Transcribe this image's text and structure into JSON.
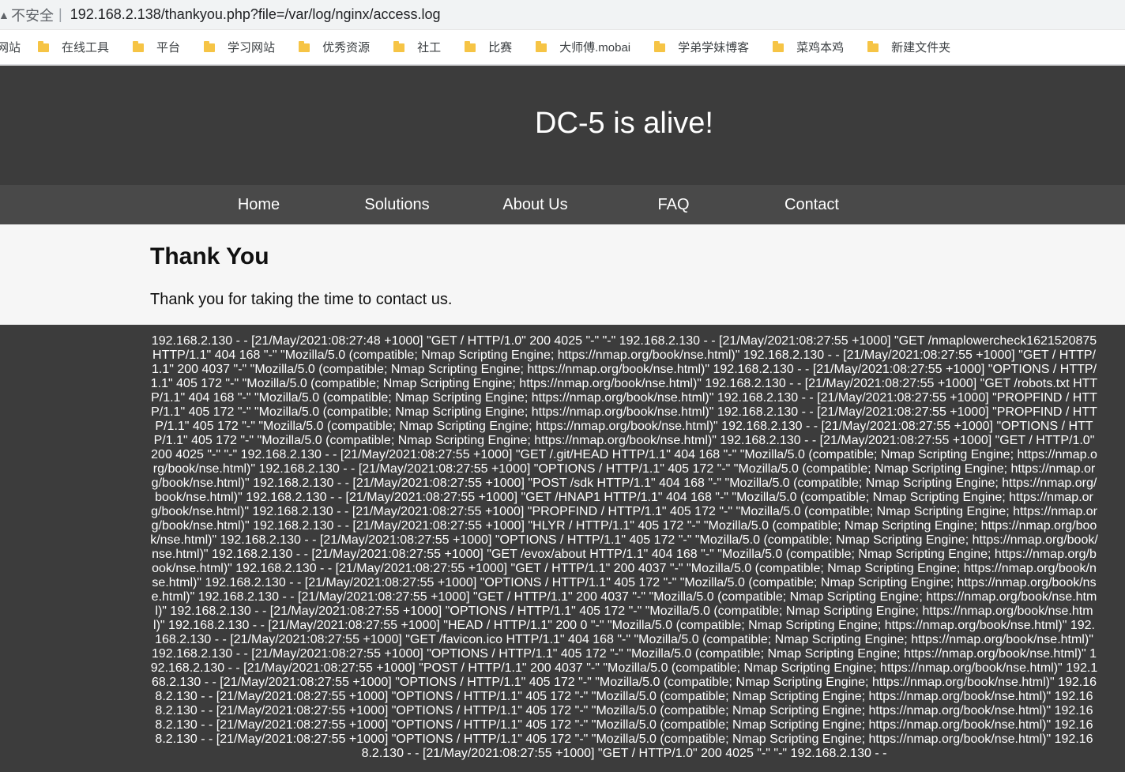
{
  "browser": {
    "insecure_label": "不安全",
    "separator": "|",
    "url": "192.168.2.138/thankyou.php?file=/var/log/nginx/access.log",
    "bookmarks": [
      "网站",
      "在线工具",
      "平台",
      "学习网站",
      "优秀资源",
      "社工",
      "比赛",
      "大师傅.mobai",
      "学弟学妹博客",
      "菜鸡本鸡",
      "新建文件夹"
    ],
    "folder_color": "#f6c445"
  },
  "site": {
    "title": "DC-5 is alive!",
    "nav": [
      "Home",
      "Solutions",
      "About Us",
      "FAQ",
      "Contact"
    ],
    "header_color": "#3c3c3c",
    "nav_color": "#494949"
  },
  "page": {
    "heading": "Thank You",
    "message": "Thank you for taking the time to contact us."
  },
  "log": {
    "text": "192.168.2.130 - - [21/May/2021:08:27:48 +1000] \"GET / HTTP/1.0\" 200 4025 \"-\" \"-\" 192.168.2.130 - - [21/May/2021:08:27:55 +1000] \"GET /nmaplowercheck1621520875 HTTP/1.1\" 404 168 \"-\" \"Mozilla/5.0 (compatible; Nmap Scripting Engine; https://nmap.org/book/nse.html)\" 192.168.2.130 - - [21/May/2021:08:27:55 +1000] \"GET / HTTP/1.1\" 200 4037 \"-\" \"Mozilla/5.0 (compatible; Nmap Scripting Engine; https://nmap.org/book/nse.html)\" 192.168.2.130 - - [21/May/2021:08:27:55 +1000] \"OPTIONS / HTTP/1.1\" 405 172 \"-\" \"Mozilla/5.0 (compatible; Nmap Scripting Engine; https://nmap.org/book/nse.html)\" 192.168.2.130 - - [21/May/2021:08:27:55 +1000] \"GET /robots.txt HTTP/1.1\" 404 168 \"-\" \"Mozilla/5.0 (compatible; Nmap Scripting Engine; https://nmap.org/book/nse.html)\" 192.168.2.130 - - [21/May/2021:08:27:55 +1000] \"PROPFIND / HTTP/1.1\" 405 172 \"-\" \"Mozilla/5.0 (compatible; Nmap Scripting Engine; https://nmap.org/book/nse.html)\" 192.168.2.130 - - [21/May/2021:08:27:55 +1000] \"PROPFIND / HTTP/1.1\" 405 172 \"-\" \"Mozilla/5.0 (compatible; Nmap Scripting Engine; https://nmap.org/book/nse.html)\" 192.168.2.130 - - [21/May/2021:08:27:55 +1000] \"OPTIONS / HTTP/1.1\" 405 172 \"-\" \"Mozilla/5.0 (compatible; Nmap Scripting Engine; https://nmap.org/book/nse.html)\" 192.168.2.130 - - [21/May/2021:08:27:55 +1000] \"GET / HTTP/1.0\" 200 4025 \"-\" \"-\" 192.168.2.130 - - [21/May/2021:08:27:55 +1000] \"GET /.git/HEAD HTTP/1.1\" 404 168 \"-\" \"Mozilla/5.0 (compatible; Nmap Scripting Engine; https://nmap.org/book/nse.html)\" 192.168.2.130 - - [21/May/2021:08:27:55 +1000] \"OPTIONS / HTTP/1.1\" 405 172 \"-\" \"Mozilla/5.0 (compatible; Nmap Scripting Engine; https://nmap.org/book/nse.html)\" 192.168.2.130 - - [21/May/2021:08:27:55 +1000] \"POST /sdk HTTP/1.1\" 404 168 \"-\" \"Mozilla/5.0 (compatible; Nmap Scripting Engine; https://nmap.org/book/nse.html)\" 192.168.2.130 - - [21/May/2021:08:27:55 +1000] \"GET /HNAP1 HTTP/1.1\" 404 168 \"-\" \"Mozilla/5.0 (compatible; Nmap Scripting Engine; https://nmap.org/book/nse.html)\" 192.168.2.130 - - [21/May/2021:08:27:55 +1000] \"PROPFIND / HTTP/1.1\" 405 172 \"-\" \"Mozilla/5.0 (compatible; Nmap Scripting Engine; https://nmap.org/book/nse.html)\" 192.168.2.130 - - [21/May/2021:08:27:55 +1000] \"HLYR / HTTP/1.1\" 405 172 \"-\" \"Mozilla/5.0 (compatible; Nmap Scripting Engine; https://nmap.org/book/nse.html)\" 192.168.2.130 - - [21/May/2021:08:27:55 +1000] \"OPTIONS / HTTP/1.1\" 405 172 \"-\" \"Mozilla/5.0 (compatible; Nmap Scripting Engine; https://nmap.org/book/nse.html)\" 192.168.2.130 - - [21/May/2021:08:27:55 +1000] \"GET /evox/about HTTP/1.1\" 404 168 \"-\" \"Mozilla/5.0 (compatible; Nmap Scripting Engine; https://nmap.org/book/nse.html)\" 192.168.2.130 - - [21/May/2021:08:27:55 +1000] \"GET / HTTP/1.1\" 200 4037 \"-\" \"Mozilla/5.0 (compatible; Nmap Scripting Engine; https://nmap.org/book/nse.html)\" 192.168.2.130 - - [21/May/2021:08:27:55 +1000] \"OPTIONS / HTTP/1.1\" 405 172 \"-\" \"Mozilla/5.0 (compatible; Nmap Scripting Engine; https://nmap.org/book/nse.html)\" 192.168.2.130 - - [21/May/2021:08:27:55 +1000] \"GET / HTTP/1.1\" 200 4037 \"-\" \"Mozilla/5.0 (compatible; Nmap Scripting Engine; https://nmap.org/book/nse.html)\" 192.168.2.130 - - [21/May/2021:08:27:55 +1000] \"OPTIONS / HTTP/1.1\" 405 172 \"-\" \"Mozilla/5.0 (compatible; Nmap Scripting Engine; https://nmap.org/book/nse.html)\" 192.168.2.130 - - [21/May/2021:08:27:55 +1000] \"HEAD / HTTP/1.1\" 200 0 \"-\" \"Mozilla/5.0 (compatible; Nmap Scripting Engine; https://nmap.org/book/nse.html)\" 192.168.2.130 - - [21/May/2021:08:27:55 +1000] \"GET /favicon.ico HTTP/1.1\" 404 168 \"-\" \"Mozilla/5.0 (compatible; Nmap Scripting Engine; https://nmap.org/book/nse.html)\" 192.168.2.130 - - [21/May/2021:08:27:55 +1000] \"OPTIONS / HTTP/1.1\" 405 172 \"-\" \"Mozilla/5.0 (compatible; Nmap Scripting Engine; https://nmap.org/book/nse.html)\" 192.168.2.130 - - [21/May/2021:08:27:55 +1000] \"POST / HTTP/1.1\" 200 4037 \"-\" \"Mozilla/5.0 (compatible; Nmap Scripting Engine; https://nmap.org/book/nse.html)\" 192.168.2.130 - - [21/May/2021:08:27:55 +1000] \"OPTIONS / HTTP/1.1\" 405 172 \"-\" \"Mozilla/5.0 (compatible; Nmap Scripting Engine; https://nmap.org/book/nse.html)\" 192.168.2.130 - - [21/May/2021:08:27:55 +1000] \"OPTIONS / HTTP/1.1\" 405 172 \"-\" \"Mozilla/5.0 (compatible; Nmap Scripting Engine; https://nmap.org/book/nse.html)\" 192.168.2.130 - - [21/May/2021:08:27:55 +1000] \"OPTIONS / HTTP/1.1\" 405 172 \"-\" \"Mozilla/5.0 (compatible; Nmap Scripting Engine; https://nmap.org/book/nse.html)\" 192.168.2.130 - - [21/May/2021:08:27:55 +1000] \"OPTIONS / HTTP/1.1\" 405 172 \"-\" \"Mozilla/5.0 (compatible; Nmap Scripting Engine; https://nmap.org/book/nse.html)\" 192.168.2.130 - - [21/May/2021:08:27:55 +1000] \"OPTIONS / HTTP/1.1\" 405 172 \"-\" \"Mozilla/5.0 (compatible; Nmap Scripting Engine; https://nmap.org/book/nse.html)\" 192.168.2.130 - - [21/May/2021:08:27:55 +1000] \"GET / HTTP/1.0\" 200 4025 \"-\" \"-\" 192.168.2.130 - -"
  }
}
